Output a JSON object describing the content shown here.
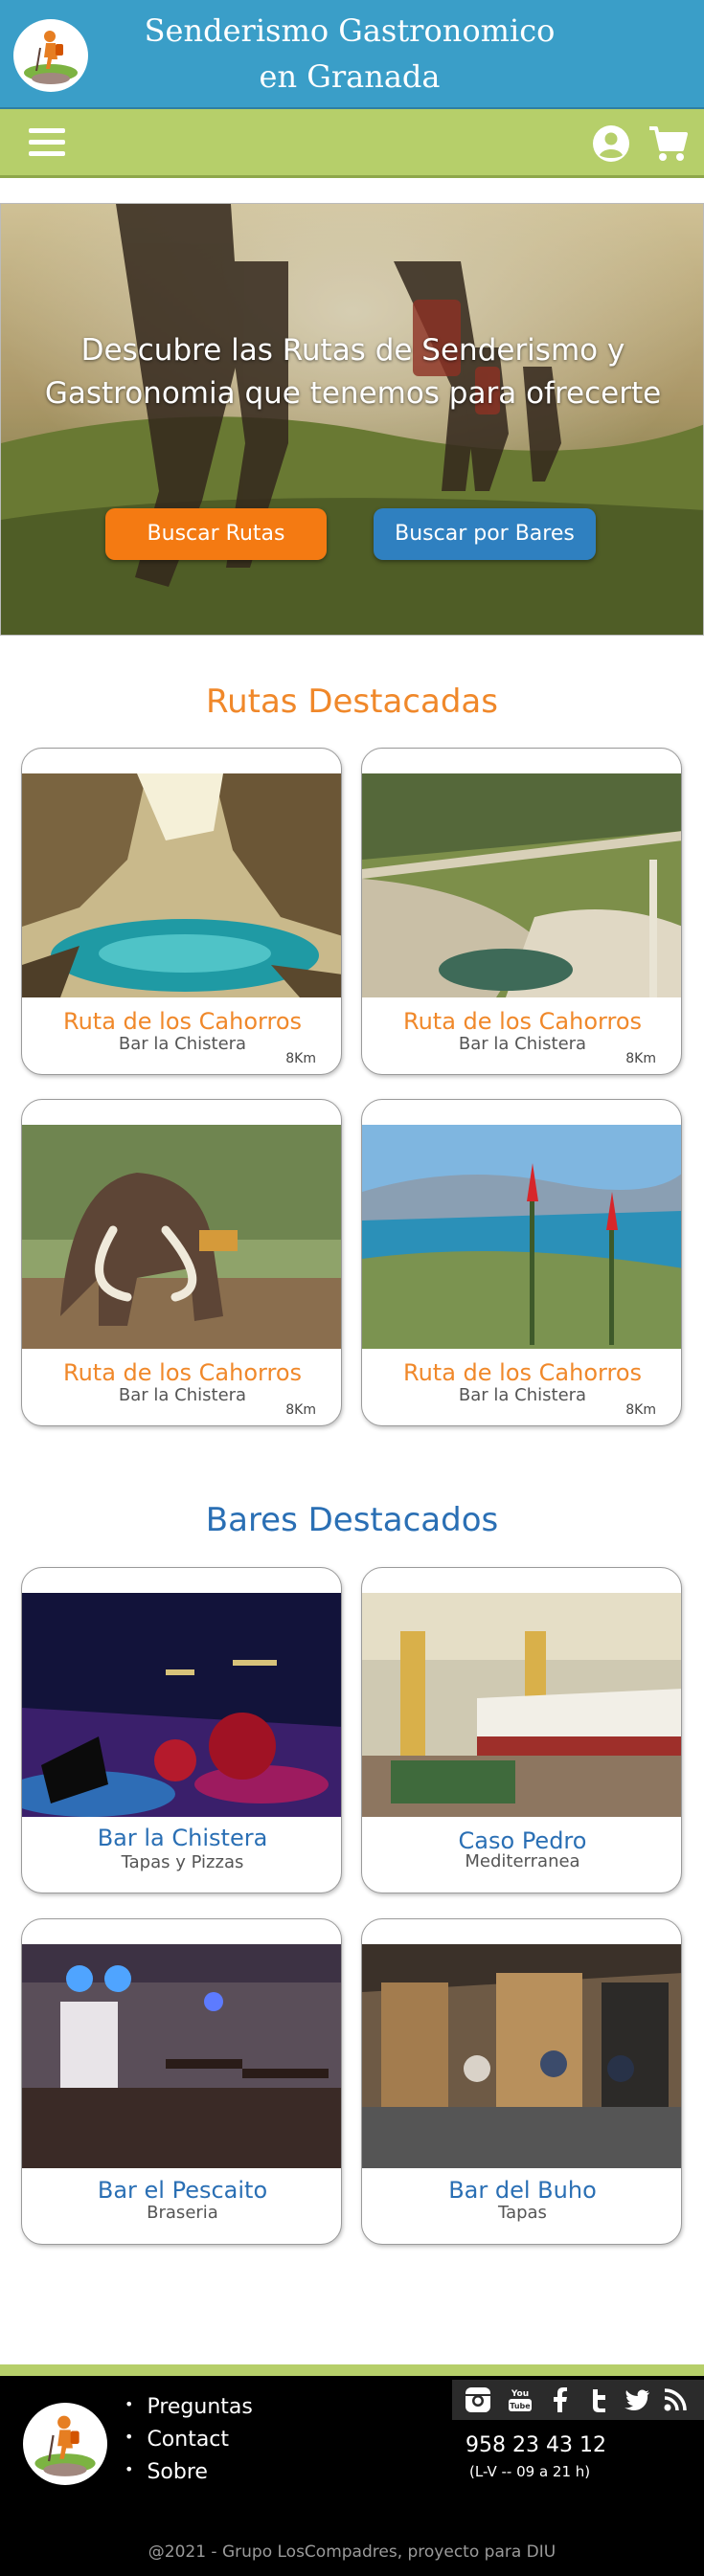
{
  "header": {
    "title_line1": "Senderismo Gastronomico",
    "title_line2": "en Granada"
  },
  "hero": {
    "text_line1": "Descubre las Rutas de Senderismo y",
    "text_line2": "Gastronomia que tenemos para ofrecerte",
    "btn_routes": "Buscar Rutas",
    "btn_bars": "Buscar por Bares"
  },
  "routes": {
    "title": "Rutas Destacadas",
    "items": [
      {
        "name": "Ruta de los Cahorros",
        "bar": "Bar la Chistera",
        "distance": "8Km"
      },
      {
        "name": "Ruta de los Cahorros",
        "bar": "Bar la Chistera",
        "distance": "8Km"
      },
      {
        "name": "Ruta de los Cahorros",
        "bar": "Bar la Chistera",
        "distance": "8Km"
      },
      {
        "name": "Ruta de los Cahorros",
        "bar": "Bar la Chistera",
        "distance": "8Km"
      }
    ]
  },
  "bars": {
    "title": "Bares Destacados",
    "items": [
      {
        "name": "Bar la Chistera",
        "type": "Tapas y Pizzas"
      },
      {
        "name": "Caso Pedro",
        "type": "Mediterranea"
      },
      {
        "name": "Bar el Pescaito",
        "type": "Braseria"
      },
      {
        "name": "Bar del Buho",
        "type": "Tapas"
      }
    ]
  },
  "footer": {
    "links": [
      "Preguntas",
      "Contact",
      "Sobre"
    ],
    "phone": "958 23 43 12",
    "hours": "(L-V -- 09 a 21 h)",
    "copyright": "@2021 - Grupo LosCompadres, proyecto para DIU"
  },
  "colors": {
    "header_blue": "#3a9ec8",
    "nav_green": "#b6cf6a",
    "accent_orange": "#f0882a",
    "accent_blue": "#2a6fb4",
    "footer_bg": "#000000"
  }
}
